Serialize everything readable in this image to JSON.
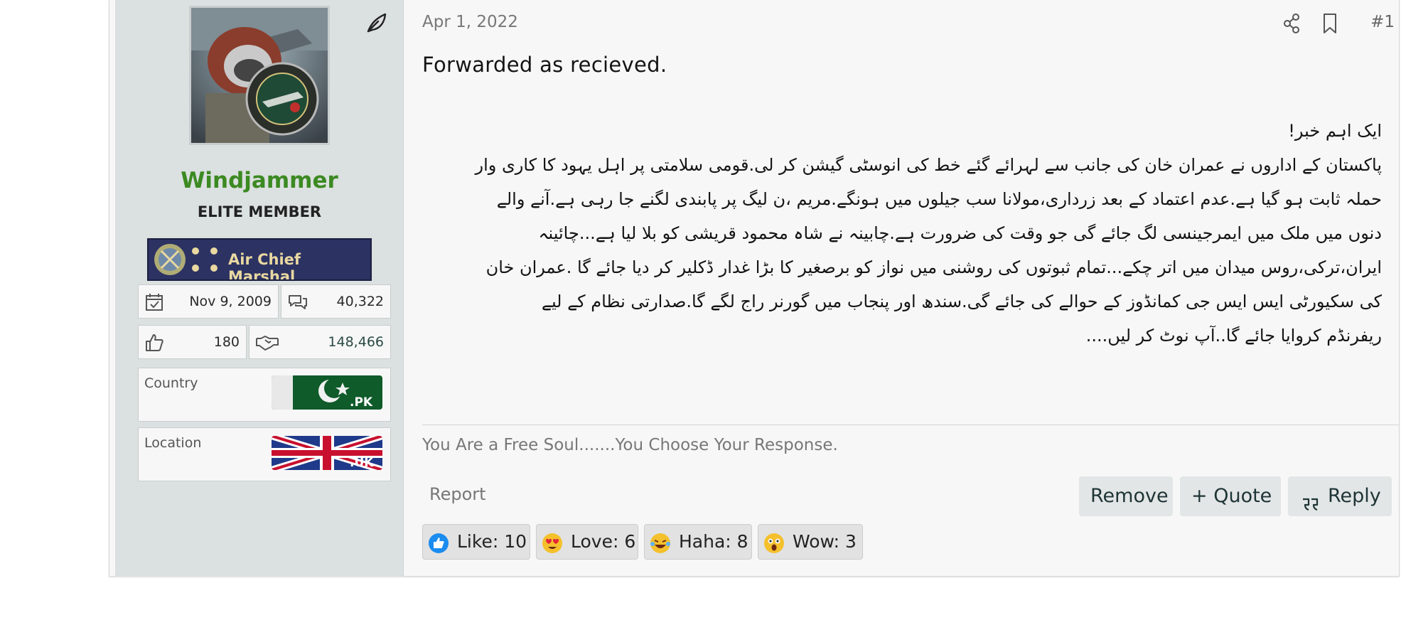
{
  "user": {
    "name": "Windjammer",
    "title": "ELITE MEMBER",
    "rank_label": "Air Chief Marshal",
    "joined": "Nov 9, 2009",
    "messages": "40,322",
    "reactions": "180",
    "points": "148,466",
    "country_label": "Country",
    "country_code": ".PK",
    "location_label": "Location",
    "location_code": ".UK"
  },
  "post": {
    "date": "Apr 1, 2022",
    "number": "#1",
    "intro": "Forwarded as recieved.",
    "urdu_lines": [
      "ایک اہم خبر!",
      "پاکستان کے اداروں نے عمران خان کی جانب سے لہرائے گئے خط کی انوسٹی گیشن کر لی.قومی سلامتی پر اہل یہود کا کاری وار",
      "حملہ ثابت ہو گیا ہے.عدم اعتماد کے بعد زرداری،مولانا سب جیلوں میں ہونگے.مریم ،ن لیگ پر پابندی لگنے جا رہی ہے.آنے والے",
      "دنوں میں ملک میں ایمرجینسی لگ جائے گی جو وقت کی ضرورت ہے.چابینہ نے شاہ محمود قریشی کو بلا لیا ہے...چائینہ",
      "ایران،ترکی،روس میدان میں اتر چکے...تمام ثبوتوں کی روشنی میں نواز کو برصغیر کا بڑا غدار ڈکلیر کر دیا جائے گا .عمران خان",
      "کی سکیورٹی ایس ایس جی کمانڈوز کے حوالے کی جائے گی.سندھ اور پنجاب میں گورنر راج لگے گا.صدارتی نظام کے لیے",
      "ریفرنڈم کروایا جائے گا..آپ نوٹ کر لیں...."
    ],
    "signature": "You Are a Free Soul.......You Choose Your Response.",
    "report_label": "Report",
    "remove_label": "Remove",
    "quote_label": "+ Quote",
    "reply_label": "Reply"
  },
  "reactions": [
    {
      "label": "Like: 10",
      "icon": "like-icon"
    },
    {
      "label": "Love: 6",
      "icon": "love-icon"
    },
    {
      "label": "Haha: 8",
      "icon": "haha-icon"
    },
    {
      "label": "Wow: 3",
      "icon": "wow-icon"
    }
  ],
  "colors": {
    "username": "#3c8a22",
    "user_column": "#dbe0e0",
    "post_bg": "#f7f7f7",
    "button_bg": "#e3e6e6"
  }
}
